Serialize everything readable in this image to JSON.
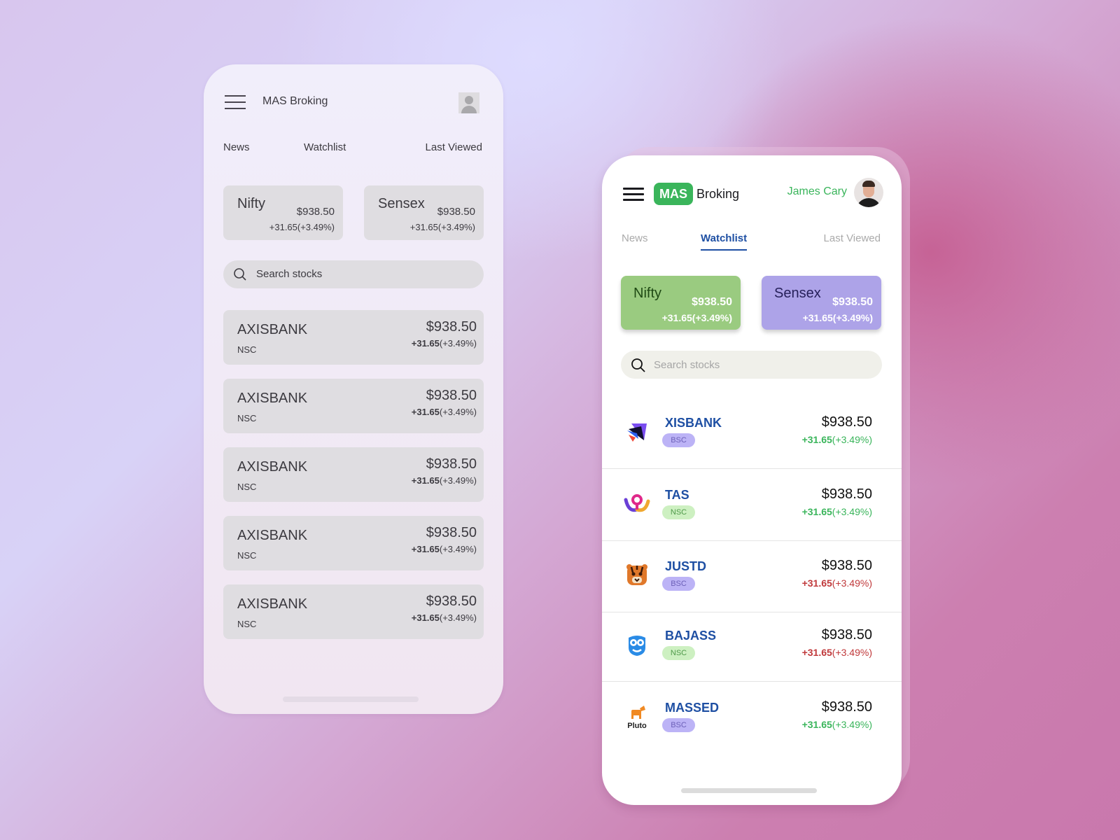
{
  "wireframe": {
    "app_title": "MAS Broking",
    "tabs": [
      "News",
      "Watchlist",
      "Last Viewed"
    ],
    "indices": [
      {
        "name": "Nifty",
        "price": "$938.50",
        "change": "+31.65(+3.49%)"
      },
      {
        "name": "Sensex",
        "price": "$938.50",
        "change": "+31.65(+3.49%)"
      }
    ],
    "search_placeholder": "Search stocks",
    "stocks": [
      {
        "symbol": "AXISBANK",
        "exchange": "NSC",
        "price": "$938.50",
        "change_abs": "+31.65",
        "change_pct": "(+3.49%)"
      },
      {
        "symbol": "AXISBANK",
        "exchange": "NSC",
        "price": "$938.50",
        "change_abs": "+31.65",
        "change_pct": "(+3.49%)"
      },
      {
        "symbol": "AXISBANK",
        "exchange": "NSC",
        "price": "$938.50",
        "change_abs": "+31.65",
        "change_pct": "(+3.49%)"
      },
      {
        "symbol": "AXISBANK",
        "exchange": "NSC",
        "price": "$938.50",
        "change_abs": "+31.65",
        "change_pct": "(+3.49%)"
      },
      {
        "symbol": "AXISBANK",
        "exchange": "NSC",
        "price": "$938.50",
        "change_abs": "+31.65",
        "change_pct": "(+3.49%)"
      }
    ]
  },
  "design": {
    "logo_badge": "MAS",
    "brand": "Broking",
    "user_name": "James Cary",
    "tabs": [
      "News",
      "Watchlist",
      "Last Viewed"
    ],
    "active_tab": "Watchlist",
    "indices": [
      {
        "name": "Nifty",
        "price": "$938.50",
        "change": "+31.65(+3.49%)",
        "color": "#9acb80"
      },
      {
        "name": "Sensex",
        "price": "$938.50",
        "change": "+31.65(+3.49%)",
        "color": "#ada3e8"
      }
    ],
    "search_placeholder": "Search stocks",
    "stocks": [
      {
        "symbol": "XISBANK",
        "exchange": "BSC",
        "price": "$938.50",
        "change_abs": "+31.65",
        "change_pct": "(+3.49%)",
        "trend": "up",
        "logo": "paper-plane-logo"
      },
      {
        "symbol": "TAS",
        "exchange": "NSC",
        "price": "$938.50",
        "change_abs": "+31.65",
        "change_pct": "(+3.49%)",
        "trend": "up",
        "logo": "w-pin-logo"
      },
      {
        "symbol": "JUSTD",
        "exchange": "BSC",
        "price": "$938.50",
        "change_abs": "+31.65",
        "change_pct": "(+3.49%)",
        "trend": "down",
        "logo": "tiger-logo"
      },
      {
        "symbol": "BAJASS",
        "exchange": "NSC",
        "price": "$938.50",
        "change_abs": "+31.65",
        "change_pct": "(+3.49%)",
        "trend": "down",
        "logo": "owl-logo"
      },
      {
        "symbol": "MASSED",
        "exchange": "BSC",
        "price": "$938.50",
        "change_abs": "+31.65",
        "change_pct": "(+3.49%)",
        "trend": "up",
        "logo": "pluto-logo",
        "logo_text": "Pluto"
      }
    ],
    "colors": {
      "accent_green": "#3ab55b",
      "link_blue": "#1e4fa3",
      "down_red": "#c0393b"
    }
  }
}
